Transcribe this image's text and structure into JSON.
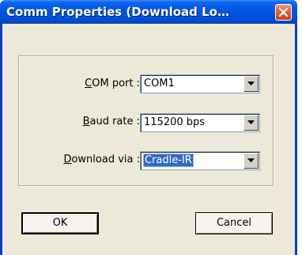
{
  "window": {
    "title": "Comm Properties (Download Lo…"
  },
  "form": {
    "com_port": {
      "label_prefix": "C",
      "label_rest": "OM port :",
      "value": "COM1"
    },
    "baud_rate": {
      "label_prefix": "B",
      "label_rest": "aud rate :",
      "value": "115200 bps"
    },
    "download_via": {
      "label_prefix": "D",
      "label_rest": "ownload via :",
      "value": "Cradle-IR"
    }
  },
  "buttons": {
    "ok": "OK",
    "cancel": "Cancel"
  },
  "icons": {
    "close": "close-icon",
    "dropdown": "chevron-down-icon"
  },
  "colors": {
    "titlebar": "#0054e3",
    "dialog_bg": "#ece9d8",
    "selection": "#316ac5",
    "close_button": "#e2613a"
  }
}
